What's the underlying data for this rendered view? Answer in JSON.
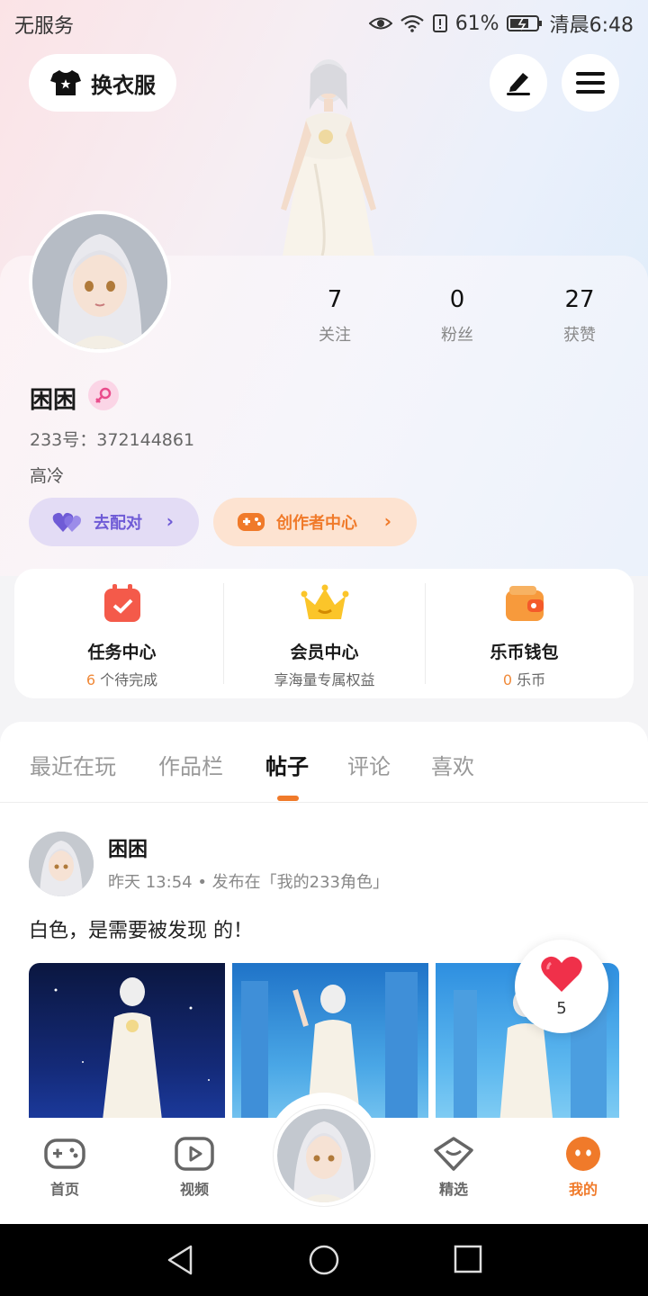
{
  "status_bar": {
    "carrier": "无服务",
    "battery": "61%",
    "time": "清晨6:48"
  },
  "header": {
    "outfit_label": "换衣服"
  },
  "profile": {
    "stats": [
      {
        "value": "7",
        "label": "关注"
      },
      {
        "value": "0",
        "label": "粉丝"
      },
      {
        "value": "27",
        "label": "获赞"
      }
    ],
    "username": "困困",
    "uid": "233号：372144861",
    "bio": "高冷",
    "match_label": "去配对",
    "creator_label": "创作者中心"
  },
  "services": [
    {
      "title": "任务中心",
      "count": "6",
      "suffix": " 个待完成"
    },
    {
      "title": "会员中心",
      "subtitle": "享海量专属权益"
    },
    {
      "title": "乐币钱包",
      "count": "0",
      "suffix": " 乐币"
    }
  ],
  "tabs": [
    "最近在玩",
    "作品栏",
    "帖子",
    "评论",
    "喜欢"
  ],
  "active_tab": "帖子",
  "post": {
    "author": "困困",
    "meta": "昨天 13:54 • 发布在「我的233角色」",
    "text": "白色，是需要被发现 的！",
    "likes": "5"
  },
  "bottom_nav": [
    {
      "label": "首页",
      "icon": "gamepad-icon"
    },
    {
      "label": "视频",
      "icon": "video-play-icon"
    },
    {
      "label": "精选",
      "icon": "heart-chat-icon"
    },
    {
      "label": "我的",
      "icon": "me-face-icon"
    }
  ],
  "colors": {
    "accent": "#f07a2a",
    "match_purple": "#6f5bd6",
    "creator_orange": "#f07a2a"
  }
}
